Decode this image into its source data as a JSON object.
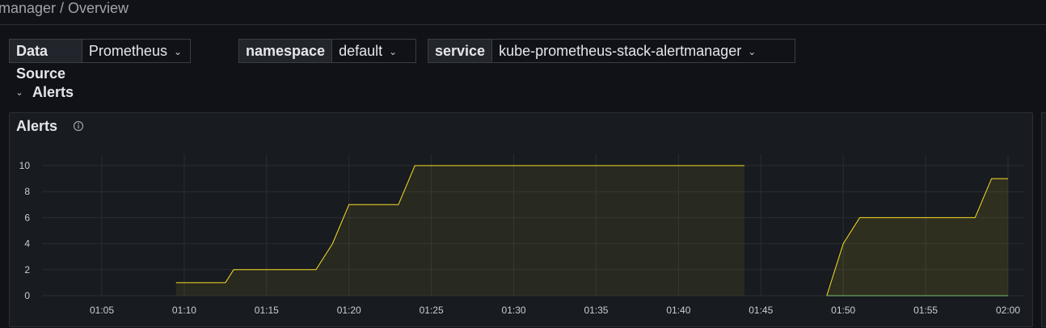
{
  "breadcrumb": "manager / Overview",
  "variables": [
    {
      "label": "Data Source",
      "value": "Prometheus"
    },
    {
      "label": "namespace",
      "value": "default"
    },
    {
      "label": "service",
      "value": "kube-prometheus-stack-alertmanager"
    }
  ],
  "row": {
    "title": "Alerts",
    "chevron": "chevron-down-icon"
  },
  "panel": {
    "title": "Alerts",
    "info_icon": "info-circle-icon"
  },
  "colors": {
    "series_yellow": "#fade2a",
    "series_green": "#73bf69",
    "grid": "#2a2d33",
    "background": "#111217",
    "panel_bg": "#181b1f"
  },
  "chart_data": {
    "type": "area",
    "title": "",
    "xlabel": "",
    "ylabel": "",
    "ylim": [
      0,
      10
    ],
    "y_ticks": [
      "0",
      "2",
      "4",
      "6",
      "8",
      "10"
    ],
    "x_ticks": [
      "01:05",
      "01:10",
      "01:15",
      "01:20",
      "01:25",
      "01:30",
      "01:35",
      "01:40",
      "01:45",
      "01:50",
      "01:55",
      "02:00"
    ],
    "grid": true,
    "series": [
      {
        "color": "#fade2a",
        "segments": [
          [
            [
              "01:09:30",
              1
            ],
            [
              "01:12:30",
              1
            ],
            [
              "01:13:00",
              2
            ],
            [
              "01:18:00",
              2
            ],
            [
              "01:19:00",
              4
            ],
            [
              "01:20:00",
              7
            ],
            [
              "01:23:00",
              7
            ],
            [
              "01:24:00",
              10
            ],
            [
              "01:44:00",
              10
            ]
          ],
          [
            [
              "01:49:00",
              0
            ],
            [
              "01:50:00",
              4
            ],
            [
              "01:51:00",
              6
            ],
            [
              "01:58:00",
              6
            ],
            [
              "01:59:00",
              9
            ],
            [
              "02:00:00",
              9
            ]
          ]
        ]
      },
      {
        "color": "#73bf69",
        "segments": [
          [
            [
              "01:49:00",
              0
            ],
            [
              "02:00:00",
              0
            ]
          ]
        ]
      }
    ]
  }
}
